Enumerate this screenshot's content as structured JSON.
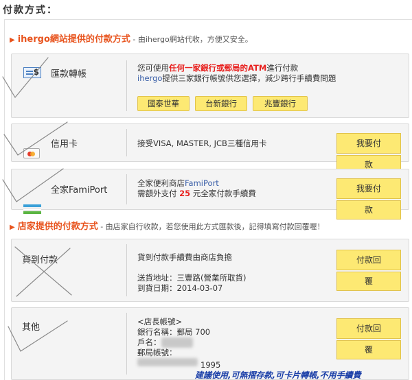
{
  "page": {
    "title": "付款方式："
  },
  "site_section": {
    "title": "ihergo網站提供的付款方式",
    "note": " - 由ihergo網站代收，方便又安全。"
  },
  "store_section": {
    "title": "店家提供的付款方式",
    "note": " - 由店家自行收款，若您使用此方式匯款後，記得填寫付款回覆喔！"
  },
  "methods": {
    "transfer": {
      "label": "匯款轉帳",
      "desc_pre": "您可使用",
      "desc_red": "任何一家銀行或郵局的",
      "desc_atm": "ATM",
      "desc_post": "進行付款",
      "desc_line2_blue": "ihergo",
      "desc_line2": "提供三家銀行帳號供您選擇，減少跨行手續費問題",
      "banks": [
        "國泰世華",
        "台新銀行",
        "兆豐銀行"
      ]
    },
    "credit": {
      "label": "信用卡",
      "desc": "接受VISA, MASTER, JCB三種信用卡",
      "btn_line1": "我要付",
      "btn_line2": "款"
    },
    "famiport": {
      "label": "全家FamiPort",
      "desc_line1_pre": "全家便利商店",
      "desc_line1_blue": "FamiPort",
      "desc_line2_pre": "需額外支付 ",
      "desc_line2_amount": "25",
      "desc_line2_post": " 元全家付款手續費",
      "btn_line1": "我要付",
      "btn_line2": "款"
    },
    "cod": {
      "label": "貨到付款",
      "desc_line1": "貨到付款手續費由商店負擔",
      "address_label": "送貨地址：",
      "address_value": "三豐路(營業所取貨)",
      "date_label": "到貨日期：",
      "date_value": "2014-03-07",
      "btn_line1": "付款回",
      "btn_line2": "覆"
    },
    "other": {
      "label": "其他",
      "line1": "<店長帳號>",
      "bank_label": "銀行名稱：",
      "bank_value": "郵局 700",
      "name_label": "戶名：",
      "account_label": "郵局帳號：",
      "account_tail": "1995",
      "btn_line1": "付款回",
      "btn_line2": "覆"
    }
  },
  "footer": {
    "note": "建議使用,可無摺存款,可卡片轉帳,不用手續費"
  }
}
